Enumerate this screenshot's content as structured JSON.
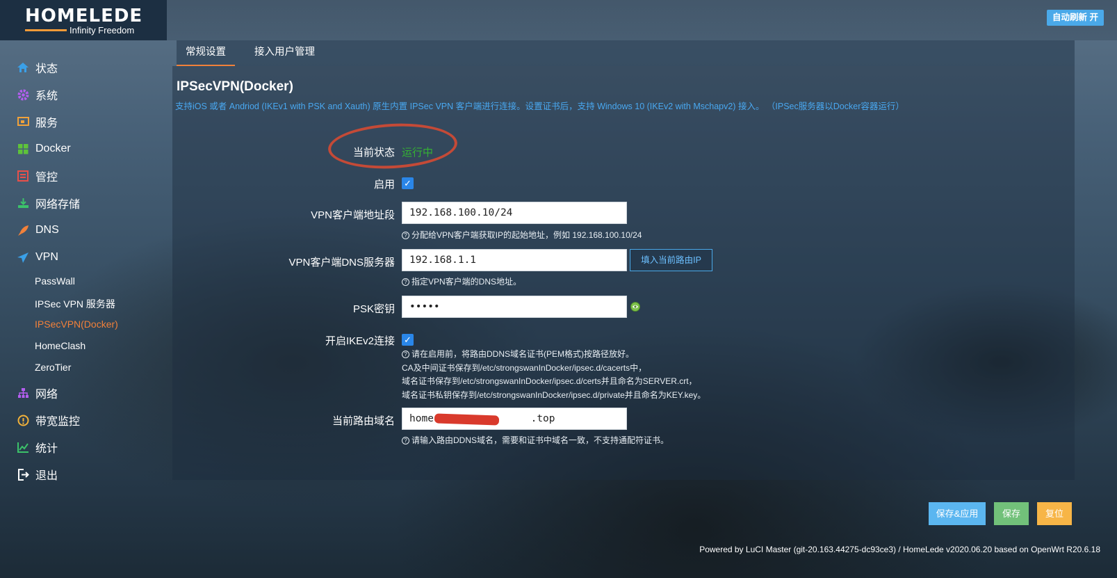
{
  "header": {
    "logo_title": "HOMELEDE",
    "logo_subtitle": "Infinity Freedom",
    "auto_refresh_label": "自动刷新 开"
  },
  "sidebar": {
    "items": [
      {
        "label": "状态",
        "icon": "home-icon"
      },
      {
        "label": "系统",
        "icon": "gear-icon"
      },
      {
        "label": "服务",
        "icon": "services-icon"
      },
      {
        "label": "Docker",
        "icon": "docker-icon"
      },
      {
        "label": "管控",
        "icon": "control-icon"
      },
      {
        "label": "网络存储",
        "icon": "storage-icon"
      },
      {
        "label": "DNS",
        "icon": "rocket-icon"
      },
      {
        "label": "VPN",
        "icon": "plane-icon"
      },
      {
        "label": "网络",
        "icon": "network-icon"
      },
      {
        "label": "带宽监控",
        "icon": "bandwidth-icon"
      },
      {
        "label": "统计",
        "icon": "chart-icon"
      },
      {
        "label": "退出",
        "icon": "logout-icon"
      }
    ],
    "vpn_sub_items": [
      {
        "label": "PassWall"
      },
      {
        "label": "IPSec VPN 服务器"
      },
      {
        "label": "IPSecVPN(Docker)",
        "active": true
      },
      {
        "label": "HomeClash"
      },
      {
        "label": "ZeroTier"
      }
    ]
  },
  "tabs": [
    {
      "label": "常规设置",
      "active": true
    },
    {
      "label": "接入用户管理",
      "active": false
    }
  ],
  "page": {
    "title": "IPSecVPN(Docker)",
    "description": "支持iOS 或者 Andriod (IKEv1 with PSK and Xauth) 原生内置 IPSec VPN 客户端进行连接。设置证书后，支持 Windows 10 (IKEv2 with Mschapv2) 接入。 （IPSec服务器以Docker容器运行）"
  },
  "form": {
    "status_label": "当前状态",
    "status_value": "运行中",
    "enable_label": "启用",
    "enable_checked": true,
    "client_subnet_label": "VPN客户端地址段",
    "client_subnet_value": "192.168.100.10/24",
    "client_subnet_help": "分配给VPN客户端获取IP的起始地址，例如 192.168.100.10/24",
    "dns_label": "VPN客户端DNS服务器",
    "dns_value": "192.168.1.1",
    "dns_fill_button": "填入当前路由IP",
    "dns_help": "指定VPN客户端的DNS地址。",
    "psk_label": "PSK密钥",
    "psk_value": "•••••",
    "ikev2_label": "开启IKEv2连接",
    "ikev2_checked": true,
    "ikev2_help_lines": [
      "请在启用前，将路由DDNS域名证书(PEM格式)按路径放好。",
      "CA及中间证书保存到/etc/strongswanInDocker/ipsec.d/cacerts中，",
      "域名证书保存到/etc/strongswanInDocker/ipsec.d/certs并且命名为SERVER.crt，",
      "域名证书私钥保存到/etc/strongswanInDocker/ipsec.d/private并且命名为KEY.key。"
    ],
    "domain_label": "当前路由域名",
    "domain_value": "home.i              .top",
    "domain_help": "请输入路由DDNS域名，需要和证书中域名一致，不支持通配符证书。"
  },
  "actions": {
    "save_apply": "保存&应用",
    "save": "保存",
    "reset": "复位"
  },
  "footer": {
    "text": "Powered by LuCI Master (git-20.163.44275-dc93ce3) / HomeLede v2020.06.20 based on OpenWrt R20.6.18"
  },
  "colors": {
    "accent_orange": "#f2813a",
    "status_green": "#34b233",
    "link_blue": "#49a8f0",
    "btn_blue": "#5bb6f0",
    "btn_green": "#72c17a",
    "btn_yellow": "#f7b547"
  }
}
